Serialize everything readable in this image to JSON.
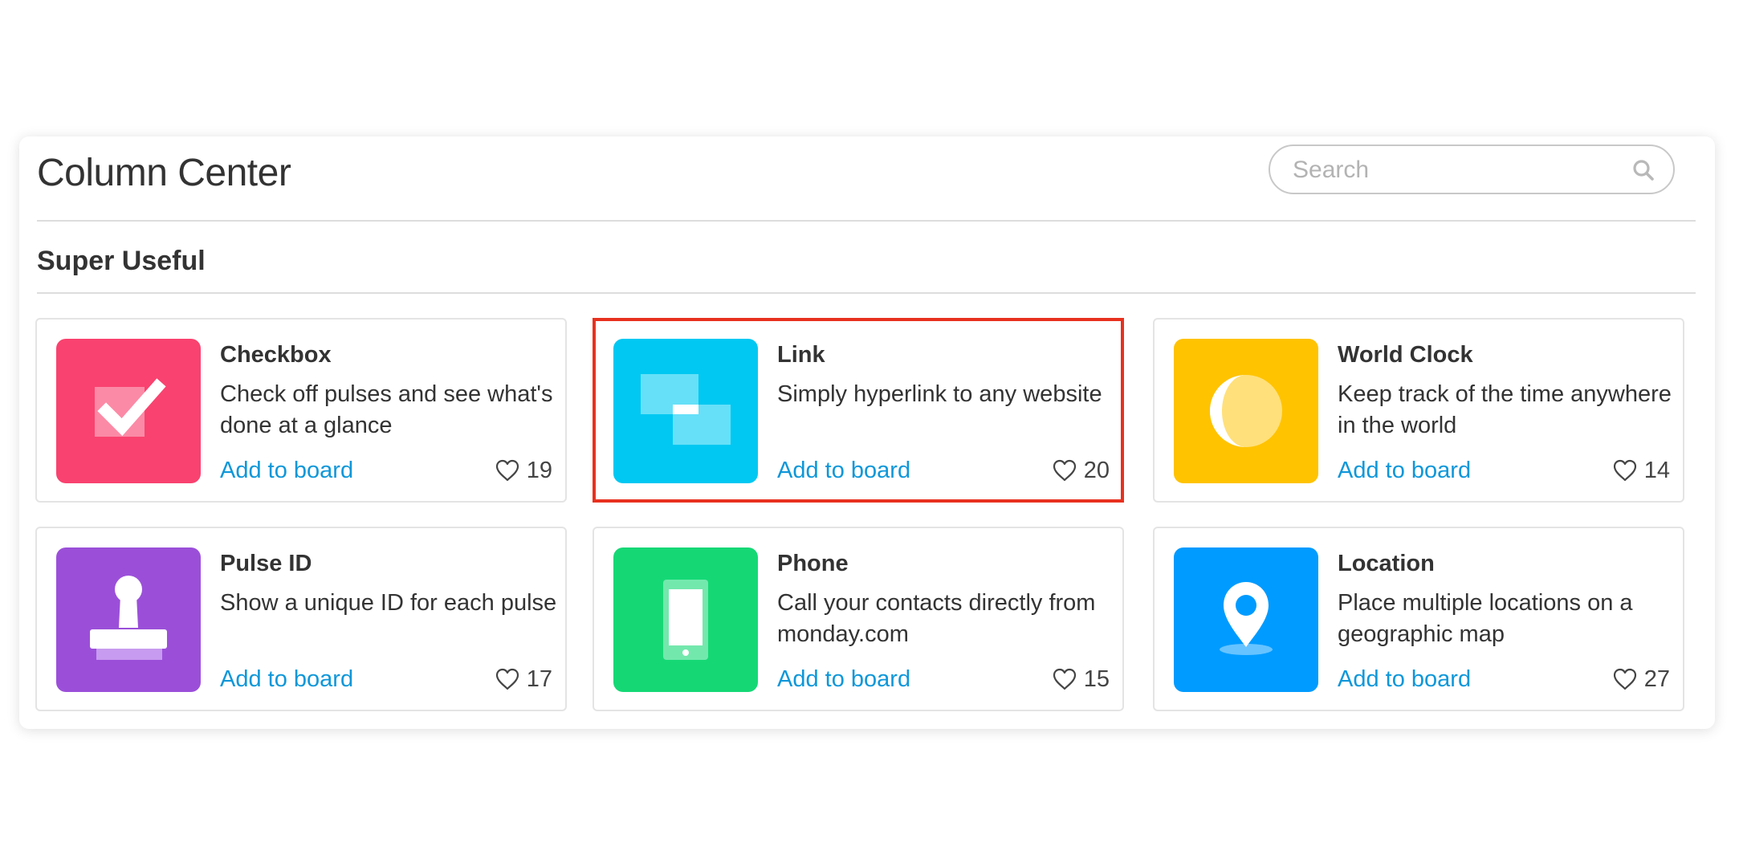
{
  "panel": {
    "title": "Column Center",
    "search": {
      "placeholder": "Search"
    },
    "section_title": "Super Useful"
  },
  "cards": [
    {
      "name": "Checkbox",
      "description": "Check off pulses and see what's done at a glance",
      "action_label": "Add to board",
      "likes": "19",
      "icon": "checkbox-icon",
      "color": "#f9426f"
    },
    {
      "name": "Link",
      "description": "Simply hyperlink to any website",
      "action_label": "Add to board",
      "likes": "20",
      "icon": "link-icon",
      "color": "#00c8f2",
      "selected": true,
      "highlight_color": "#e8311f"
    },
    {
      "name": "World Clock",
      "description": "Keep track of the time anywhere in the world",
      "action_label": "Add to board",
      "likes": "14",
      "icon": "moon-icon",
      "color": "#ffc300"
    },
    {
      "name": "Pulse ID",
      "description": "Show a unique ID for each pulse",
      "action_label": "Add to board",
      "likes": "17",
      "icon": "stamp-icon",
      "color": "#9b4fd9"
    },
    {
      "name": "Phone",
      "description": "Call your contacts directly from monday.com",
      "action_label": "Add to board",
      "likes": "15",
      "icon": "phone-icon",
      "color": "#15d875"
    },
    {
      "name": "Location",
      "description": "Place multiple locations on a geographic map",
      "action_label": "Add to board",
      "likes": "27",
      "icon": "location-pin-icon",
      "color": "#009bff"
    }
  ],
  "colors": {
    "link_blue": "#0e97d9",
    "text": "#333333",
    "border": "#e4e4e4"
  }
}
